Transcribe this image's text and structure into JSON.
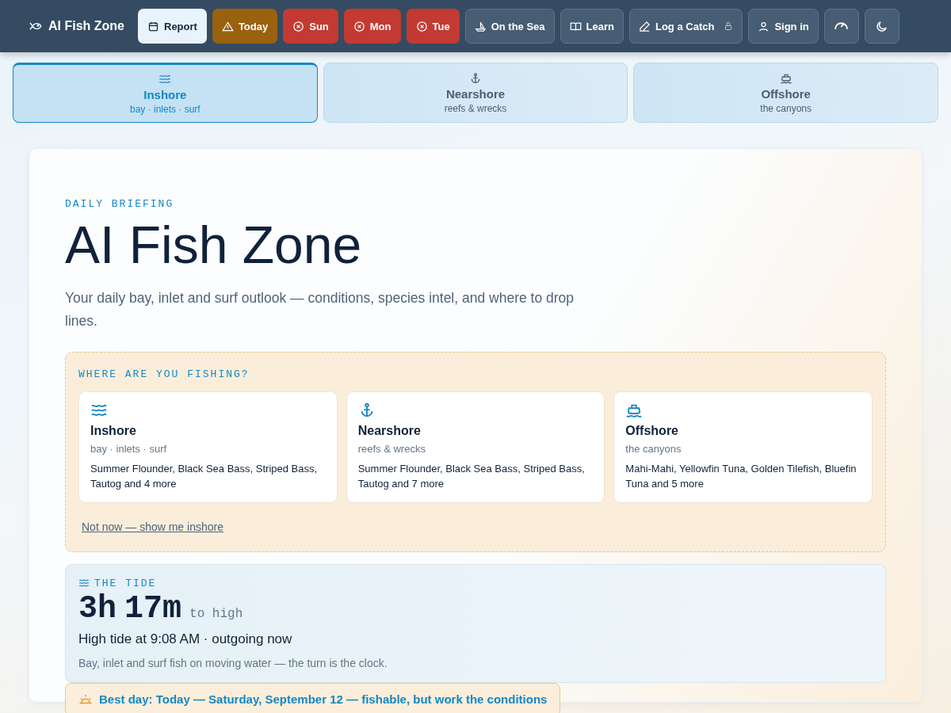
{
  "brand": "AI Fish Zone",
  "nav": [
    {
      "label": "Report",
      "kind": "light",
      "locked": false
    },
    {
      "label": "Today",
      "kind": "warn",
      "locked": false
    },
    {
      "label": "Sun",
      "kind": "danger",
      "locked": false
    },
    {
      "label": "Mon",
      "kind": "danger",
      "locked": false
    },
    {
      "label": "Tue",
      "kind": "danger",
      "locked": false
    },
    {
      "label": "On the Sea",
      "kind": "plain",
      "locked": false
    },
    {
      "label": "Learn",
      "kind": "plain",
      "locked": false
    },
    {
      "label": "Log a Catch",
      "kind": "plain",
      "locked": true
    },
    {
      "label": "Sign in",
      "kind": "plain",
      "locked": false
    }
  ],
  "zone_tabs": [
    {
      "label": "Inshore",
      "sub": "bay · inlets · surf",
      "selected": true
    },
    {
      "label": "Nearshore",
      "sub": "reefs & wrecks",
      "selected": false
    },
    {
      "label": "Offshore",
      "sub": "the canyons",
      "selected": false
    }
  ],
  "hero": {
    "eyebrow": "DAILY BRIEFING",
    "title": "AI Fish Zone",
    "subtitle": "Your daily bay, inlet and surf outlook — conditions, species intel, and where to drop lines."
  },
  "chooser": {
    "heading": "WHERE ARE YOU FISHING?",
    "cards": [
      {
        "title": "Inshore",
        "sub": "bay · inlets · surf",
        "species": "Summer Flounder, Black Sea Bass, Striped Bass, Tautog and 4 more"
      },
      {
        "title": "Nearshore",
        "sub": "reefs & wrecks",
        "species": "Summer Flounder, Black Sea Bass, Striped Bass, Tautog and 7 more"
      },
      {
        "title": "Offshore",
        "sub": "the canyons",
        "species": "Mahi-Mahi, Yellowfin Tuna, Golden Tilefish, Bluefin Tuna and 5 more"
      }
    ],
    "skip_link": "Not now — show me inshore"
  },
  "tide": {
    "heading": "THE TIDE",
    "hours": "3h",
    "minutes": "17m",
    "suffix": "to high",
    "detail": "High tide at 9:08 AM · outgoing now",
    "note": "Bay, inlet and surf fish on moving water — the turn is the clock."
  },
  "best_day": "Best day: Today — Saturday, September 12 — fishable, but work the conditions"
}
